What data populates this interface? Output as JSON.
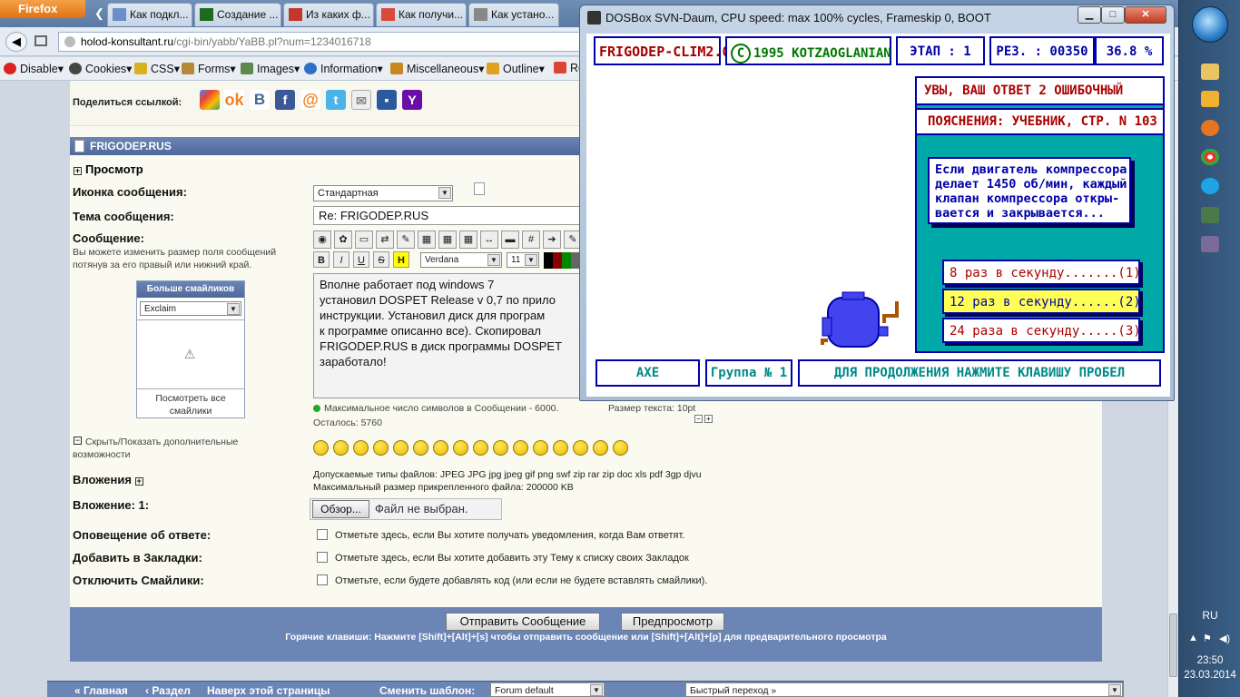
{
  "browser": {
    "app_button": "Firefox",
    "tabs": [
      {
        "label": "Как подкл..."
      },
      {
        "label": "Создание ..."
      },
      {
        "label": "Из каких ф..."
      },
      {
        "label": "Как получи..."
      },
      {
        "label": "Как устано..."
      }
    ],
    "url_host": "holod-konsultant.ru",
    "url_rest": "/cgi-bin/yabb/YaBB.pl?num=1234016718",
    "devbar": [
      "Disable",
      "Cookies",
      "CSS",
      "Forms",
      "Images",
      "Information",
      "Miscellaneous",
      "Outline",
      "Re"
    ]
  },
  "forum": {
    "share_label": "Поделиться ссылкой:",
    "share_icons": [
      "google-icon",
      "odnoklassniki-icon",
      "vkontakte-icon",
      "facebook-icon",
      "mail-icon",
      "twitter-icon",
      "email-icon",
      "myspace-icon",
      "yahoo-icon"
    ],
    "section_title": "FRIGODEP.RUS",
    "preview_toggle": "Просмотр",
    "icon_label": "Иконка сообщения:",
    "icon_value": "Стандартная",
    "subject_label": "Тема сообщения:",
    "subject_value": "Re: FRIGODEP.RUS",
    "message_label": "Сообщение:",
    "message_hint": "Вы можете изменить размер поля сообщений потянув за его правый или нижний край.",
    "font_value": "Verdana",
    "size_value": "11",
    "message_lines": [
      "Вполне работает под windows 7",
      "установил DOSPET Release v 0,7 по прило",
      "инструкции. Установил диск для програм",
      "к программе описанно все). Скопировал",
      "FRIGODEP.RUS в диск программы DOSPET",
      "заработало!"
    ],
    "more_smilies": "Больше смайликов",
    "smiley_select": "Exclaim",
    "view_all_smilies": "Посмотреть все смайлики",
    "max_chars": "Максимальное число символов в Сообщении - 6000.",
    "text_size": "Размер текста:  10pt",
    "remaining": "Осталось:  5760",
    "toggle_options": "Скрыть/Показать дополнительные возможности",
    "attachments_label": "Вложения",
    "allowed_types": "Допускаемые типы файлов: JPEG JPG jpg jpeg gif png swf zip rar zip doc xls pdf 3gp djvu",
    "max_size": "Максимальный размер прикрепленного файла: 200000 KB",
    "attachment1_label": "Вложение: 1:",
    "browse_button": "Обзор...",
    "no_file": "Файл не выбран.",
    "notify_label": "Оповещение об ответе:",
    "notify_text": "Отметьте здесь, если Вы хотите получать уведомления, когда Вам ответят.",
    "bookmark_label": "Добавить в Закладки:",
    "bookmark_text": "Отметьте здесь, если Вы хотите добавить эту Тему к списку своих Закладок",
    "nosmilies_label": "Отключить Смайлики:",
    "nosmilies_text": "Отметьте, если будете добавлять код (или если не будете вставлять смайлики).",
    "submit_button": "Отправить Сообщение",
    "preview_button": "Предпросмотр",
    "hotkeys": "Горячие клавиши: Нажмите [Shift]+[Alt]+[s] чтобы отправить сообщение или [Shift]+[Alt]+[p] для предварительного просмотра",
    "bottom_nav": [
      "« Главная",
      "‹ Раздел",
      "Наверх этой страницы",
      "Сменить шаблон:"
    ],
    "template_value": "Forum default",
    "quick_jump": "Быстрый переход »"
  },
  "dosbox": {
    "title": "DOSBox SVN-Daum, CPU speed: max 100% cycles, Frameskip  0,      BOOT",
    "app_title": "FRIGODEP-CLIM2.0",
    "copyright": "1995 KOTZAOGLANIAN",
    "copyright_symbol": "C",
    "stage": "ЭТАП  : 1",
    "result": "РЕЗ.  : 00350",
    "percent": "36.8 %",
    "wrong_answer": "УВЫ, ВАШ ОТВЕТ 2 ОШИБОЧНЫЙ",
    "explanation": "ПОЯСНЕНИЯ: УЧЕБНИК, СТР. N 103",
    "question_lines": [
      "Если двигатель компрессора",
      "делает 1450 об/мин, каждый",
      "клапан компрессора откры-",
      "вается и закрывается..."
    ],
    "options": [
      "8 раз в секунду.......(1)",
      "12 раз в секунду......(2)",
      "24 раза в секунду.....(3)"
    ],
    "selected_option": 2,
    "student": "AXE",
    "group": "Группа № 1",
    "continue_prompt": "ДЛЯ ПРОДОЛЖЕНИЯ НАЖМИТЕ КЛАВИШУ ПРОБЕЛ"
  },
  "taskbar": {
    "language": "RU",
    "time": "23:50",
    "date": "23.03.2014"
  },
  "colors": {
    "dos_blue": "#0000aa",
    "dos_cyan": "#00a8a8",
    "dos_red": "#aa0000",
    "dos_yellow": "#ffff55",
    "forum_header": "#6b85b5"
  }
}
